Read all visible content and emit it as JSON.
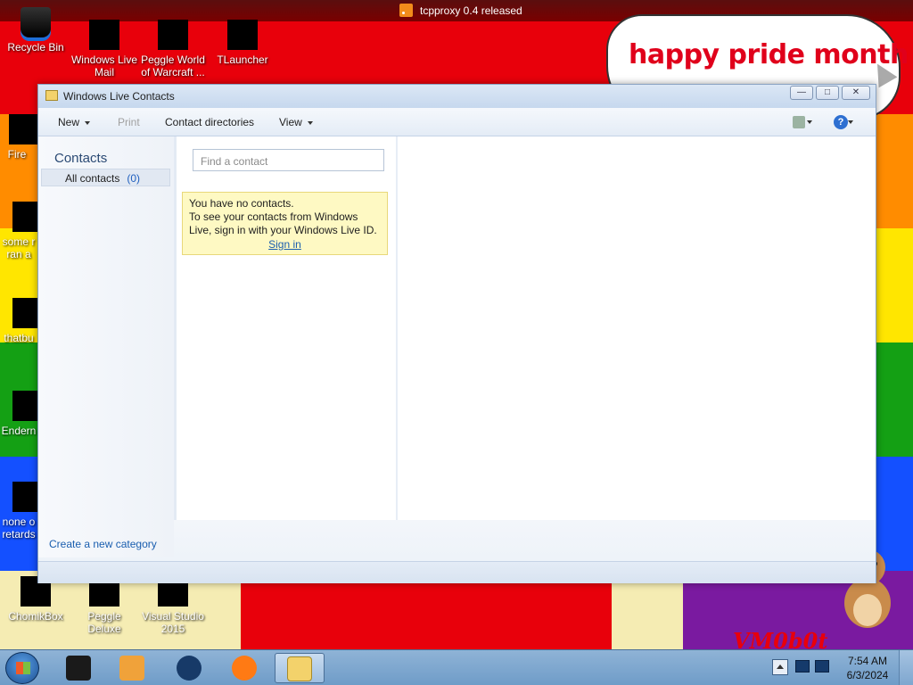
{
  "desktop": {
    "notification": "tcpproxy 0.4 released",
    "bubble_text": "happy pride month",
    "watermark": "VM0b0t",
    "icons": [
      {
        "label": "Recycle Bin"
      },
      {
        "label": "Windows Live Mail"
      },
      {
        "label": "Peggle World of Warcraft ..."
      },
      {
        "label": "TLauncher"
      },
      {
        "label": "Fire"
      },
      {
        "label": "some r ran a"
      },
      {
        "label": "thatbu"
      },
      {
        "label": "Endern"
      },
      {
        "label": "none o retards"
      },
      {
        "label": "ChomikBox"
      },
      {
        "label": "Peggle Deluxe"
      },
      {
        "label": "Visual Studio 2015"
      }
    ]
  },
  "window": {
    "title": "Windows Live Contacts",
    "menu": {
      "new": "New",
      "print": "Print",
      "contact_directories": "Contact directories",
      "view": "View",
      "help_symbol": "?"
    },
    "left": {
      "heading": "Contacts",
      "all_contacts_label": "All contacts",
      "all_contacts_count": "(0)",
      "create_category": "Create a new category"
    },
    "search": {
      "placeholder": "Find a contact"
    },
    "notice": {
      "line1": "You have no contacts.",
      "line2": "To see your contacts from Windows Live, sign in with your Windows Live ID.",
      "sign_in": "Sign in"
    },
    "controls": {
      "minimize": "—",
      "maximize": "□",
      "close": "✕"
    }
  },
  "taskbar": {
    "time": "7:54 AM",
    "date": "6/3/2024",
    "items": [
      "start-button",
      "taskbar-app-1",
      "taskbar-media-player",
      "taskbar-globe",
      "taskbar-firefox",
      "taskbar-contacts"
    ]
  }
}
